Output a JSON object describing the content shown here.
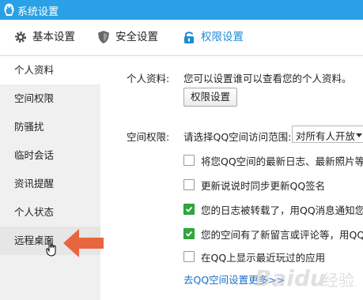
{
  "window": {
    "title": "系统设置"
  },
  "tabs": [
    {
      "label": "基本设置",
      "icon": "gear-icon",
      "active": false
    },
    {
      "label": "安全设置",
      "icon": "shield-icon",
      "active": false
    },
    {
      "label": "权限设置",
      "icon": "lock-icon",
      "active": true
    }
  ],
  "sidebar": {
    "items": [
      {
        "label": "个人资料",
        "state": "selected"
      },
      {
        "label": "空间权限",
        "state": "normal"
      },
      {
        "label": "防骚扰",
        "state": "normal"
      },
      {
        "label": "临时会话",
        "state": "normal"
      },
      {
        "label": "资讯提醒",
        "state": "normal"
      },
      {
        "label": "个人状态",
        "state": "normal"
      },
      {
        "label": "远程桌面",
        "state": "hover"
      }
    ]
  },
  "profile": {
    "label": "个人资料:",
    "description": "您可以设置谁可以查看您的个人资料。",
    "button_label": "权限设置"
  },
  "space": {
    "label": "空间权限:",
    "range_label": "请选择QQ空间访问范围:",
    "range_selected": "对所有人开放",
    "options": [
      {
        "text": "将您QQ空间的最新日志、最新照片等显",
        "checked": false
      },
      {
        "text": "更新说说时同步更新QQ签名",
        "checked": false
      },
      {
        "text": "您的日志被转载了，用QQ消息通知您",
        "checked": true
      },
      {
        "text": "您的空间有了新留言或评论等，用QQ消",
        "checked": true
      },
      {
        "text": "在QQ上显示最近玩过的应用",
        "checked": false
      }
    ],
    "more_link": "去QQ空间设置更多>>"
  },
  "watermark": {
    "text": "Baidu 经验"
  },
  "colors": {
    "titlebar": "#2aa0e6",
    "active_tab": "#1e8ad6",
    "checkbox_checked": "#2fa93a",
    "annotation_arrow": "#e8663d",
    "link": "#1a6fc7"
  }
}
